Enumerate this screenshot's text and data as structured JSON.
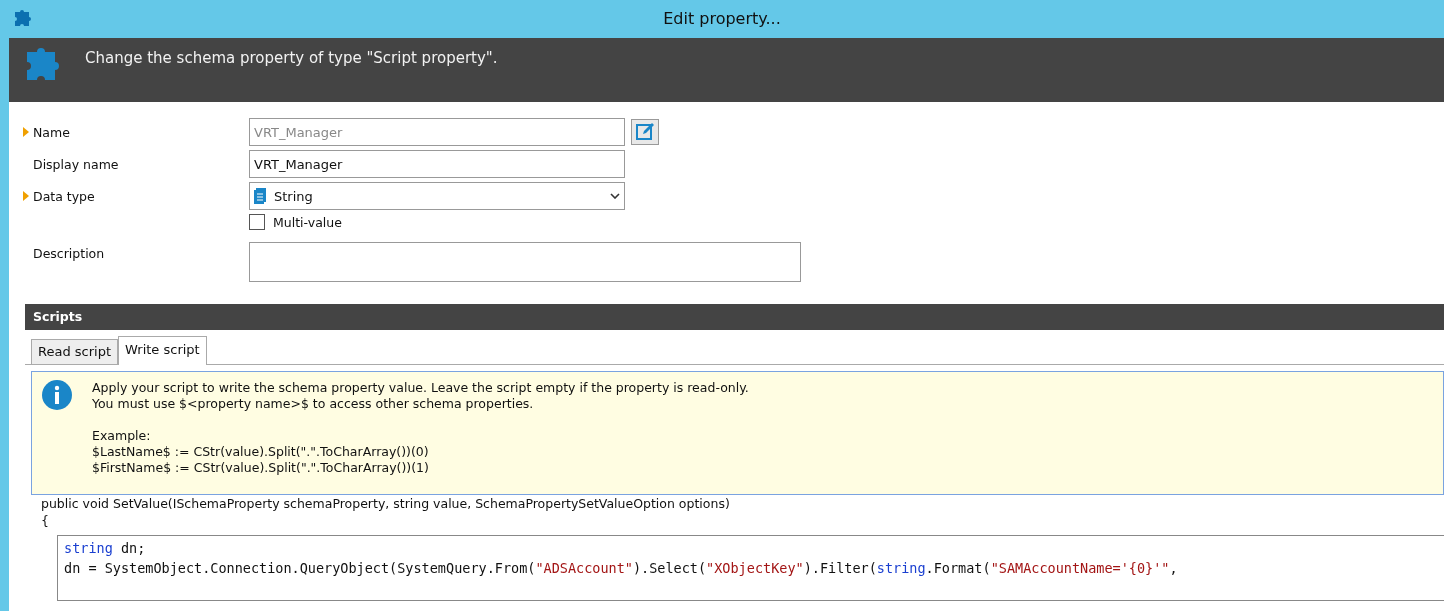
{
  "window": {
    "title": "Edit property..."
  },
  "header": {
    "text": "Change the schema property of type \"Script property\"."
  },
  "fields": [
    {
      "kind": "text",
      "label": "Name",
      "required": true,
      "value": "VRT_Manager",
      "disabled": true,
      "edit_button": true
    },
    {
      "kind": "text",
      "label": "Display name",
      "required": false,
      "value": "VRT_Manager",
      "disabled": false
    },
    {
      "kind": "select",
      "label": "Data type",
      "required": true,
      "value": "String"
    },
    {
      "kind": "checkbox",
      "label": "Multi-value",
      "checked": false
    },
    {
      "kind": "textarea",
      "label": "Description",
      "required": false
    }
  ],
  "scripts": {
    "title": "Scripts",
    "tabs": [
      {
        "label": "Read script",
        "selected": false
      },
      {
        "label": "Write script",
        "selected": true
      }
    ],
    "info_paragraphs": [
      [
        "Apply your script to write the schema property value. Leave the script empty if the property is read-only.",
        "You must use $<property name>$ to access other schema properties."
      ],
      [
        "Example:",
        "$LastName$ := CStr(value).Split(\".\".ToCharArray())(0)",
        "$FirstName$ := CStr(value).Split(\".\".ToCharArray())(1)"
      ]
    ],
    "signature": "public void SetValue(ISchemaProperty schemaProperty, string value, SchemaPropertySetValueOption options)",
    "open_brace": "{",
    "code_lines": [
      [
        {
          "kind": "keyword",
          "text": "string"
        },
        {
          "kind": "plain",
          "text": " dn;"
        }
      ],
      [
        {
          "kind": "plain",
          "text": "dn = SystemObject.Connection.QueryObject(SystemQuery.From("
        },
        {
          "kind": "string",
          "text": "\"ADSAccount\""
        },
        {
          "kind": "plain",
          "text": ").Select("
        },
        {
          "kind": "string",
          "text": "\"XObjectKey\""
        },
        {
          "kind": "plain",
          "text": ").Filter("
        },
        {
          "kind": "keyword",
          "text": "string"
        },
        {
          "kind": "plain",
          "text": ".Format("
        },
        {
          "kind": "string",
          "text": "\"SAMAccountName='{0}'\""
        },
        {
          "kind": "plain",
          "text": ","
        }
      ]
    ]
  }
}
